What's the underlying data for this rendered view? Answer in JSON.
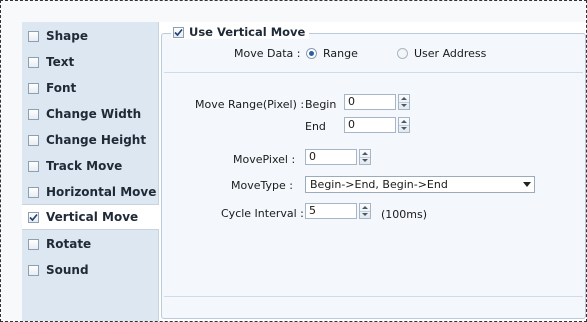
{
  "sidebar": {
    "items": [
      {
        "label": "Shape",
        "checked": false
      },
      {
        "label": "Text",
        "checked": false
      },
      {
        "label": "Font",
        "checked": false
      },
      {
        "label": "Change Width",
        "checked": false
      },
      {
        "label": "Change Height",
        "checked": false
      },
      {
        "label": "Track Move",
        "checked": false
      },
      {
        "label": "Horizontal Move",
        "checked": false
      },
      {
        "label": "Vertical Move",
        "checked": true,
        "selected": true
      },
      {
        "label": "Rotate",
        "checked": false
      },
      {
        "label": "Sound",
        "checked": false
      }
    ]
  },
  "group": {
    "title": "Use Vertical Move",
    "checked": true
  },
  "move_data": {
    "label": "Move Data :",
    "options": [
      {
        "label": "Range",
        "selected": true
      },
      {
        "label": "User Address",
        "selected": false
      }
    ]
  },
  "move_range": {
    "label": "Move Range(Pixel) :",
    "begin_label": "Begin",
    "begin_value": "0",
    "end_label": "End",
    "end_value": "0"
  },
  "move_pixel": {
    "label": "MovePixel :",
    "value": "0"
  },
  "move_type": {
    "label": "MoveType :",
    "value": "Begin->End, Begin->End"
  },
  "cycle_interval": {
    "label": "Cycle Interval :",
    "value": "5",
    "unit": "(100ms)"
  },
  "colors": {
    "sidebar_bg": "#dde7f2",
    "panel_bg": "#f4f8fc",
    "accent": "#2a5fa6"
  }
}
